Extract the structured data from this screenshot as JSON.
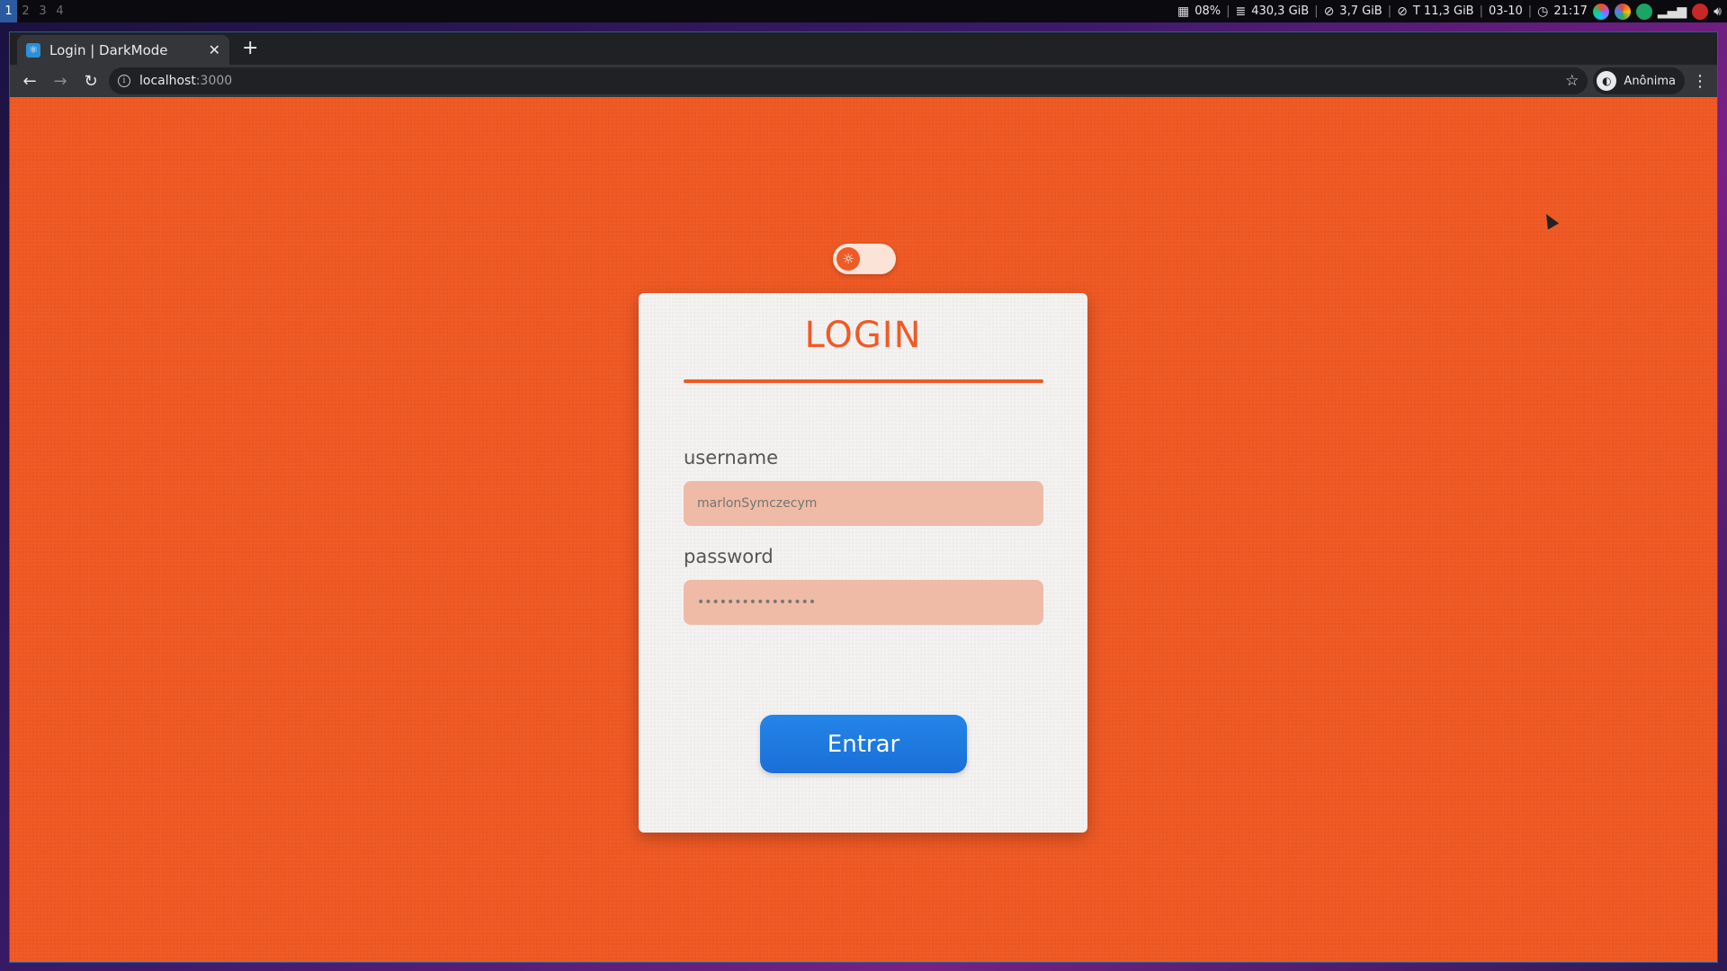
{
  "desktop": {
    "workspaces": [
      "1",
      "2",
      "3",
      "4"
    ],
    "active_workspace": "1",
    "status": {
      "cpu": "08%",
      "disk": "430,3 GiB",
      "mem": "3,7 GiB",
      "swap": "T 11,3 GiB",
      "date": "03-10",
      "time": "21:17"
    }
  },
  "browser": {
    "tab": {
      "title": "Login | DarkMode",
      "favicon": "react-icon"
    },
    "new_tab_label": "+",
    "url": {
      "host": "localhost",
      "port": ":3000"
    },
    "profile_label": "Anônima",
    "icons": {
      "back": "back-arrow-icon",
      "forward": "forward-arrow-icon",
      "reload": "reload-icon",
      "info": "info-icon",
      "star": "star-icon",
      "menu": "kebab-menu-icon"
    }
  },
  "page": {
    "background_color": "#f05a25",
    "theme_toggle": {
      "state": "light",
      "icon": "sun-icon"
    },
    "login": {
      "title": "LOGIN",
      "username_label": "username",
      "username_placeholder": "marlonSymczecym",
      "password_label": "password",
      "password_value": "••••••••••••••••",
      "submit_label": "Entrar"
    },
    "accent_color": "#f05a25",
    "button_color": "#1f7ae0"
  }
}
